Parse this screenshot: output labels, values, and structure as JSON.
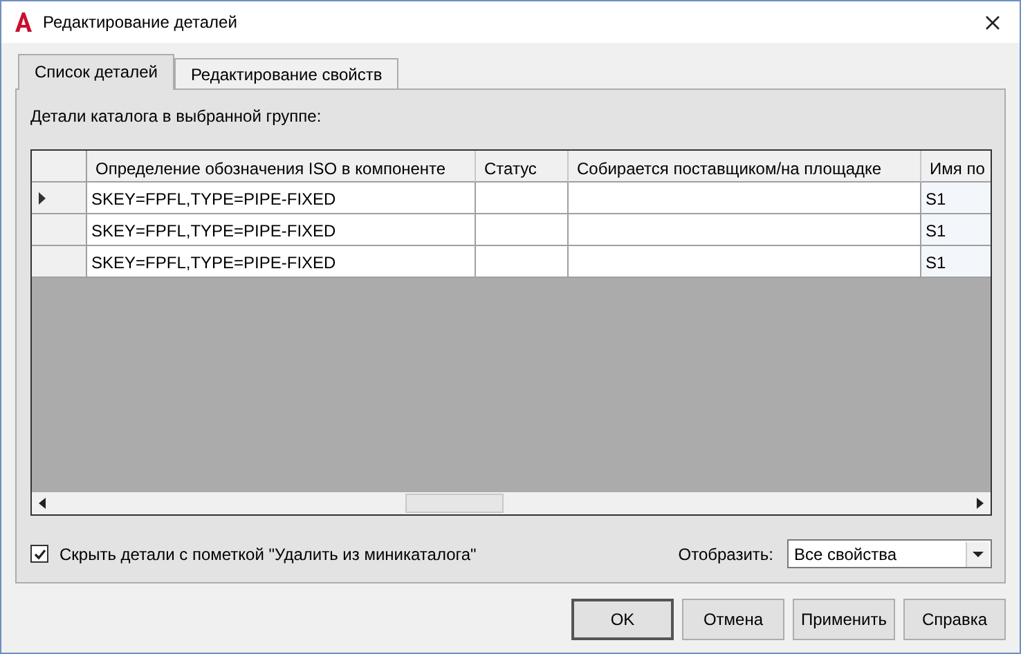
{
  "window": {
    "title": "Редактирование деталей"
  },
  "tabs": [
    {
      "label": "Список деталей",
      "selected": true
    },
    {
      "label": "Редактирование свойств",
      "selected": false
    }
  ],
  "panel_label": "Детали каталога в выбранной группе:",
  "table": {
    "columns": [
      "Определение обозначения ISO в компоненте",
      "Статус",
      "Собирается поставщиком/на площадке",
      "Имя по"
    ],
    "rows": [
      {
        "selected": true,
        "cells": [
          "SKEY=FPFL,TYPE=PIPE-FIXED",
          "",
          "",
          "S1"
        ]
      },
      {
        "selected": false,
        "cells": [
          "SKEY=FPFL,TYPE=PIPE-FIXED",
          "",
          "",
          "S1"
        ]
      },
      {
        "selected": false,
        "cells": [
          "SKEY=FPFL,TYPE=PIPE-FIXED",
          "",
          "",
          "S1"
        ]
      }
    ]
  },
  "hide_checkbox": {
    "label": "Скрыть детали с пометкой \"Удалить из миникаталога\"",
    "checked": true
  },
  "display": {
    "label": "Отобразить:",
    "value": "Все свойства"
  },
  "buttons": [
    {
      "label": "OK",
      "default": true
    },
    {
      "label": "Отмена",
      "default": false
    },
    {
      "label": "Применить",
      "default": false
    },
    {
      "label": "Справка",
      "default": false
    }
  ]
}
